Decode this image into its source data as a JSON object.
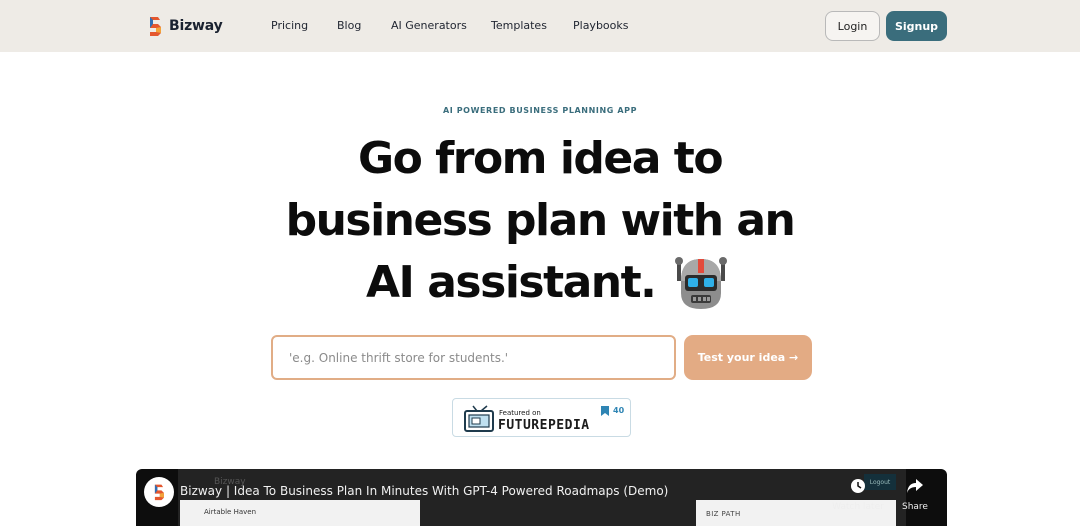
{
  "header": {
    "brand": "Bizway",
    "nav": [
      "Pricing",
      "Blog",
      "AI Generators",
      "Templates",
      "Playbooks"
    ],
    "login_label": "Login",
    "signup_label": "Signup"
  },
  "hero": {
    "eyebrow": "AI POWERED BUSINESS PLANNING APP",
    "line1": "Go from idea to",
    "line2": "business plan with an",
    "line3": "AI assistant.",
    "robot_icon": "robot-emoji-icon",
    "input_placeholder": "'e.g. Online thrift store for students.'",
    "input_value": "",
    "cta_label": "Test your idea →"
  },
  "badge": {
    "featured_on": "Featured on",
    "name": "FUTUREPEDIA",
    "count": "40"
  },
  "video": {
    "title": "Bizway | Idea To Business Plan In Minutes With GPT-4 Powered Roadmaps (Demo)",
    "watch_later_label": "Watch later",
    "share_label": "Share",
    "frame_brand": "Bizway",
    "frame_workspace": "Airtable Haven",
    "frame_section": "BIZ PATH",
    "frame_logout": "Logout"
  },
  "colors": {
    "header_bg": "#eeebe6",
    "accent_teal": "#3a6d7c",
    "cta_peach": "#e3ab84",
    "input_border": "#e1ad86"
  }
}
